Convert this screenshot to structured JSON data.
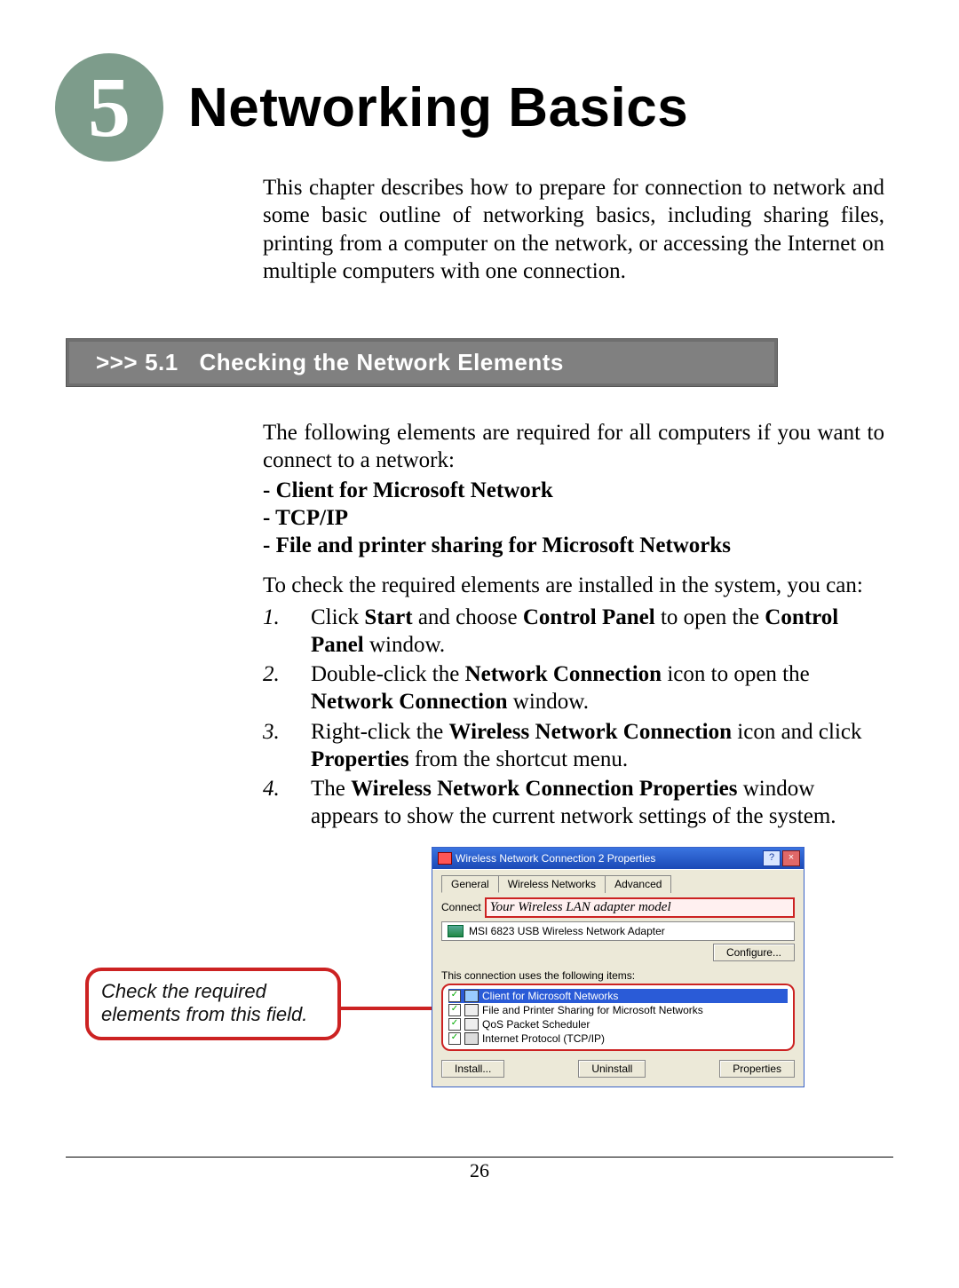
{
  "chapter": {
    "number": "5",
    "title": "Networking Basics",
    "intro": "This chapter describes how to prepare for connection to network and some basic outline of networking basics, including sharing files, printing from a computer on the network, or accessing the Internet on multiple computers with one connection."
  },
  "section": {
    "prefix": ">>>",
    "number": "5.1",
    "title": "Checking the Network Elements"
  },
  "para_required_intro": "The following elements are required for all computers if you want to connect to a network:",
  "required_items": {
    "a": "- Client for Microsoft Network",
    "b": "- TCP/IP",
    "c": "- File and printer sharing for Microsoft Networks"
  },
  "para_check_intro": "To check the required elements are installed in the system, you can:",
  "steps": {
    "n1": "1.",
    "s1_pre": "Click ",
    "s1_b1": "Start",
    "s1_mid": " and choose ",
    "s1_b2": "Control Panel",
    "s1_mid2": " to open the ",
    "s1_b3": "Control Panel",
    "s1_post": " window.",
    "n2": "2.",
    "s2_pre": "Double-click the ",
    "s2_b1": "Network Connection",
    "s2_mid": " icon to open the ",
    "s2_b2": "Network Connection",
    "s2_post": " window.",
    "n3": "3.",
    "s3_pre": "Right-click the ",
    "s3_b1": "Wireless Network Connection",
    "s3_mid": " icon and click ",
    "s3_b2": "Properties",
    "s3_post": " from the shortcut menu.",
    "n4": "4.",
    "s4_pre": "The ",
    "s4_b1": "Wireless Network Connection Properties",
    "s4_post": " window appears to show the current network settings of the system."
  },
  "dialog": {
    "title": "Wireless Network Connection 2 Properties",
    "help": "?",
    "close": "×",
    "tabs": {
      "general": "General",
      "wireless": "Wireless Networks",
      "advanced": "Advanced"
    },
    "connect_label": "Connect",
    "adapter_hint": "Your Wireless LAN adapter model",
    "adapter_name": "MSI 6823 USB Wireless Network Adapter",
    "configure": "Configure...",
    "items_label": "This connection uses the following items:",
    "items": {
      "i1": "Client for Microsoft Networks",
      "i2": "File and Printer Sharing for Microsoft Networks",
      "i3": "QoS Packet Scheduler",
      "i4": "Internet Protocol (TCP/IP)"
    },
    "install": "Install...",
    "uninstall": "Uninstall",
    "properties": "Properties"
  },
  "callout": "Check the required elements from this field.",
  "page_number": "26"
}
